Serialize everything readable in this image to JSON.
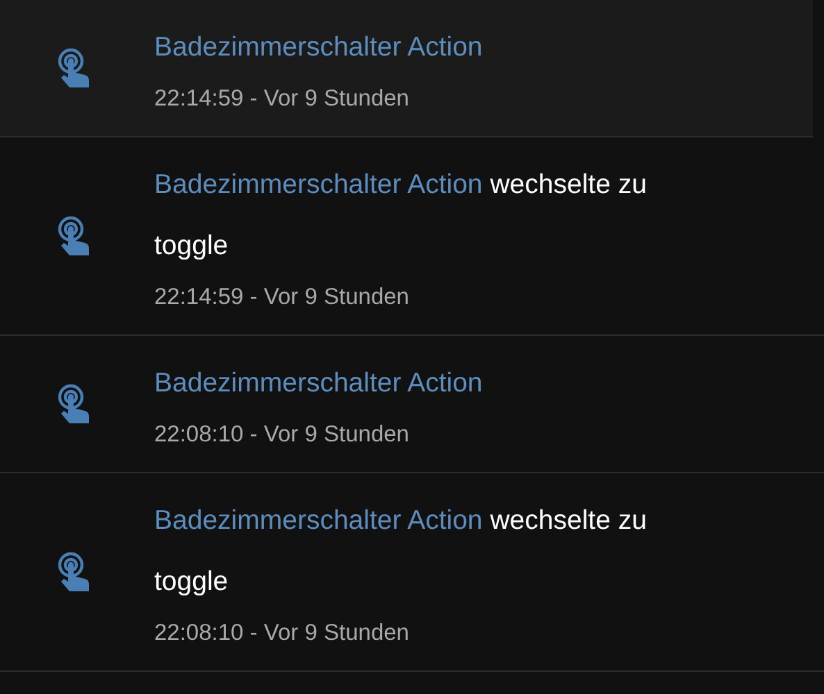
{
  "entries": [
    {
      "name": "Badezimmerschalter Action",
      "time": "22:14:59 - Vor 9 Stunden",
      "highlighted": true
    },
    {
      "name": "Badezimmerschalter Action",
      "message": "wechselte zu toggle",
      "time": "22:14:59 - Vor 9 Stunden",
      "highlighted": false
    },
    {
      "name": "Badezimmerschalter Action",
      "time": "22:08:10 - Vor 9 Stunden",
      "highlighted": false
    },
    {
      "name": "Badezimmerschalter Action",
      "message": "wechselte zu toggle",
      "time": "22:08:10 - Vor 9 Stunden",
      "highlighted": false
    }
  ]
}
